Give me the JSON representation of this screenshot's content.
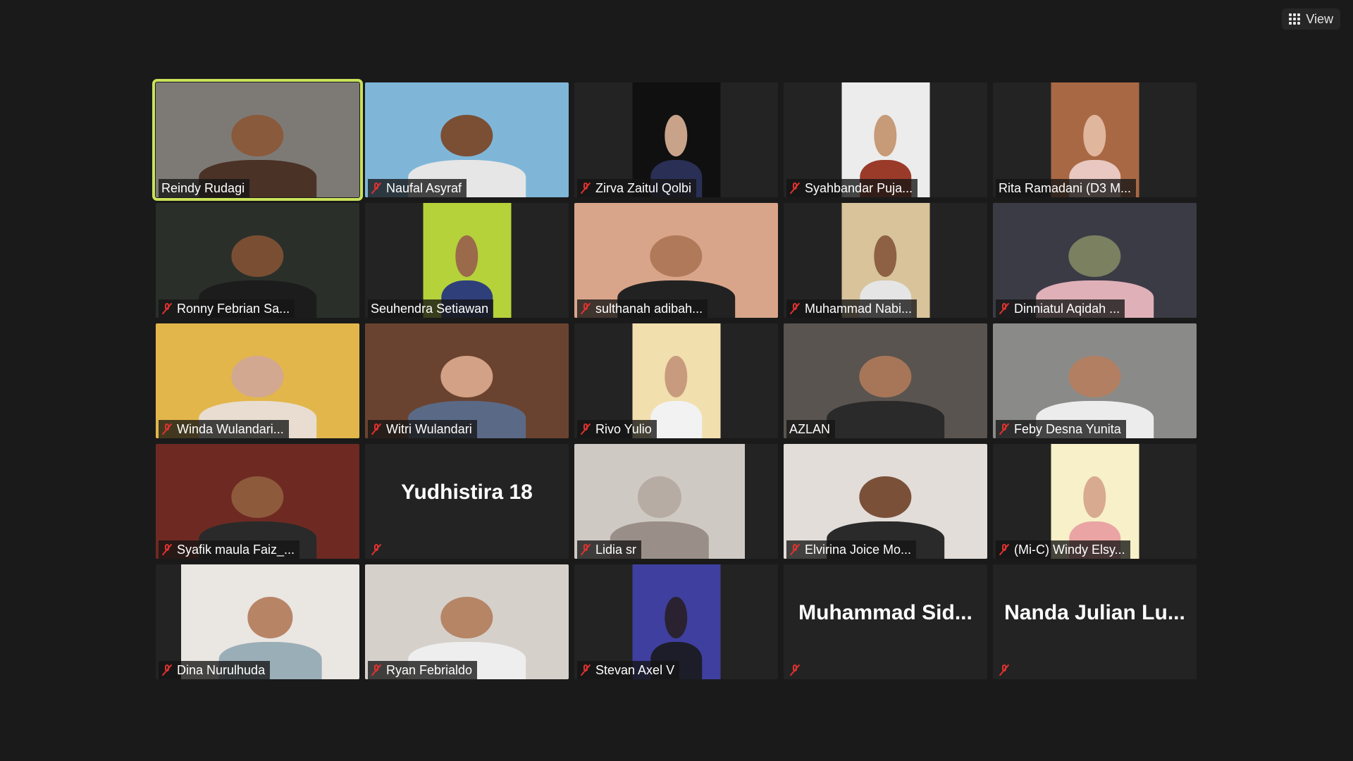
{
  "toolbar": {
    "view_label": "View",
    "view_icon": "grid-icon"
  },
  "gallery": {
    "participants": [
      {
        "name": "Reindy Rudagi",
        "muted": false,
        "video": true,
        "active": true,
        "bg": "#7d7a76",
        "skin": "#8a5a3c",
        "shirt": "#4a3226"
      },
      {
        "name": "Naufal Asyraf",
        "muted": true,
        "video": true,
        "bg": "#7fb6d8",
        "skin": "#7b4f34",
        "shirt": "#e6e6e6"
      },
      {
        "name": "Zirva Zaitul Qolbi",
        "muted": true,
        "video": true,
        "bg": "#101010",
        "skin": "#c8a38a",
        "shirt": "#2a2f55"
      },
      {
        "name": "Syahbandar Puja...",
        "muted": true,
        "video": true,
        "bg": "#ececec",
        "skin": "#c79a78",
        "shirt": "#9a3b2a"
      },
      {
        "name": "Rita Ramadani (D3 M...",
        "muted": false,
        "video": true,
        "bg": "#a86844",
        "skin": "#e0b69d",
        "shirt": "#e8c8c0"
      },
      {
        "name": "Ronny Febrian Sa...",
        "muted": true,
        "video": true,
        "bg": "#2a2f2a",
        "skin": "#7a4e33",
        "shirt": "#1c1c1c"
      },
      {
        "name": "Seuhendra Setiawan",
        "muted": false,
        "video": true,
        "bg": "#b5d23a",
        "skin": "#9b6a4b",
        "shirt": "#2f3f7a"
      },
      {
        "name": "sulthanah adibah...",
        "muted": true,
        "video": true,
        "bg": "#d9a58a",
        "skin": "#b07a5a",
        "shirt": "#222222"
      },
      {
        "name": "Muhammad Nabi...",
        "muted": true,
        "video": true,
        "bg": "#d8c39a",
        "skin": "#8e6044",
        "shirt": "#e5e5e5"
      },
      {
        "name": "Dinniatul Aqidah ...",
        "muted": true,
        "video": true,
        "bg": "#3b3b46",
        "skin": "#7a8060",
        "shirt": "#e0b0b8"
      },
      {
        "name": "Winda Wulandari...",
        "muted": true,
        "video": true,
        "bg": "#e2b64b",
        "skin": "#d2a890",
        "shirt": "#e8ddd0"
      },
      {
        "name": "Witri Wulandari",
        "muted": true,
        "video": true,
        "bg": "#6a4330",
        "skin": "#d3a185",
        "shirt": "#5a6a86"
      },
      {
        "name": "Rivo Yulio",
        "muted": true,
        "video": true,
        "bg": "#f1dfae",
        "skin": "#c99b7e",
        "shirt": "#f2f2f2"
      },
      {
        "name": "AZLAN",
        "muted": false,
        "video": true,
        "bg": "#59544f",
        "skin": "#a77658",
        "shirt": "#2a2a2a"
      },
      {
        "name": "Feby Desna Yunita",
        "muted": true,
        "video": true,
        "bg": "#8a8a88",
        "skin": "#b27f62",
        "shirt": "#ececec"
      },
      {
        "name": "Syafik maula Faiz_...",
        "muted": true,
        "video": true,
        "bg": "#6e2a22",
        "skin": "#8d5a3c",
        "shirt": "#2a2a2a"
      },
      {
        "name": "Yudhistira 18",
        "muted": true,
        "video": false
      },
      {
        "name": "Lidia sr",
        "muted": true,
        "video": true,
        "bg": "#cfc9c3",
        "skin": "#b7aca3",
        "shirt": "#9a8f88"
      },
      {
        "name": "Elvirina Joice Mo...",
        "muted": true,
        "video": true,
        "bg": "#e2ddd8",
        "skin": "#7b5039",
        "shirt": "#2a2a2a"
      },
      {
        "name": "(Mi-C) Windy Elsy...",
        "muted": true,
        "video": true,
        "bg": "#f7f0c8",
        "skin": "#d8aa8f",
        "shirt": "#eaa4a4"
      },
      {
        "name": "Dina Nurulhuda",
        "muted": true,
        "video": true,
        "bg": "#eae6e2",
        "skin": "#b88466",
        "shirt": "#9aaeb8"
      },
      {
        "name": "Ryan Febrialdo",
        "muted": true,
        "video": true,
        "bg": "#d6d0cb",
        "skin": "#b58565",
        "shirt": "#eeeeee"
      },
      {
        "name": "Stevan Axel V",
        "muted": true,
        "video": true,
        "bg": "#3f3fa0",
        "skin": "#2a2230",
        "shirt": "#1d1d2a"
      },
      {
        "name": "Muhammad  Sid...",
        "muted": true,
        "video": false
      },
      {
        "name": "Nanda  Julian  Lu...",
        "muted": true,
        "video": false
      }
    ]
  }
}
